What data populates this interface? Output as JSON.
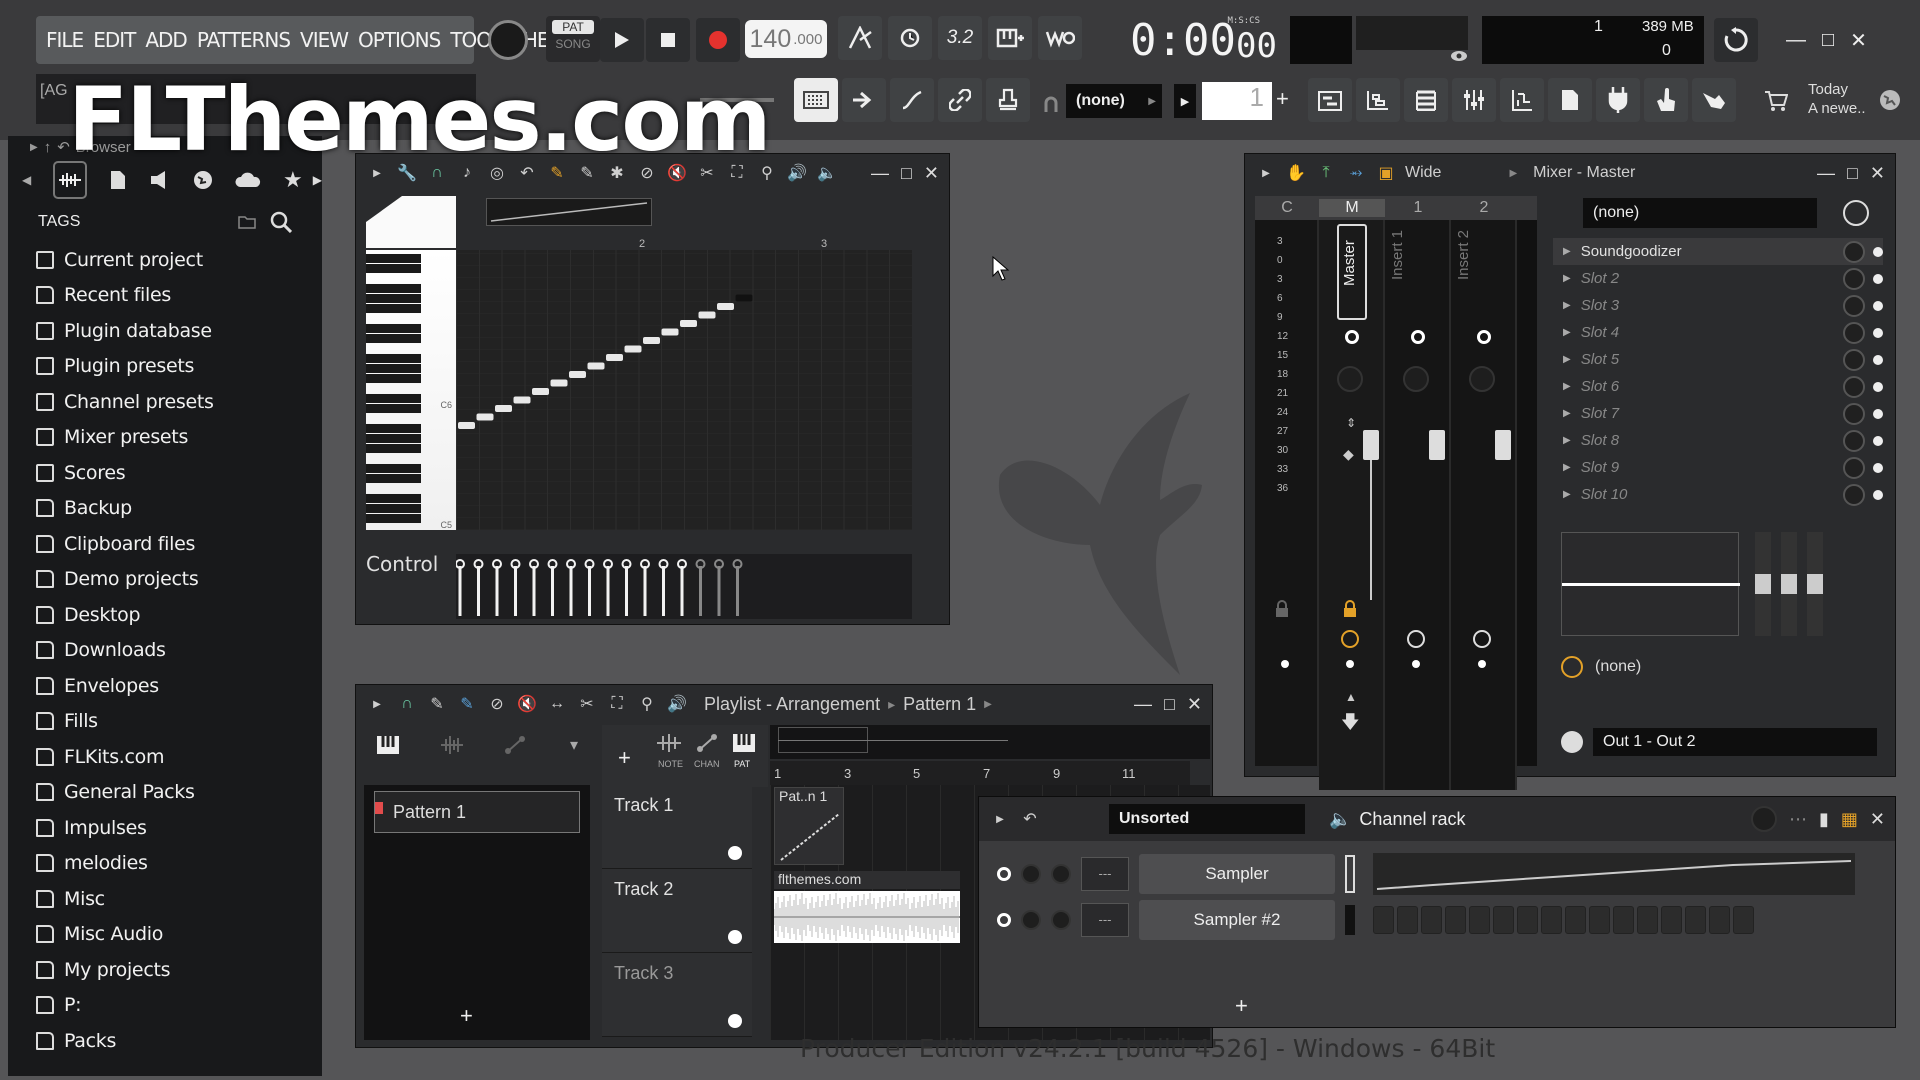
{
  "menu": {
    "file": "FILE",
    "edit": "EDIT",
    "add": "ADD",
    "patterns": "PATTERNS",
    "view": "VIEW",
    "options": "OPTIONS",
    "tools": "TOOLS",
    "help": "HELP"
  },
  "transport": {
    "pat": "PAT",
    "song": "SONG",
    "tempo_main": "140",
    "tempo_frac": ".000",
    "time_main": "0:00",
    "time_sub": "00",
    "time_label": "M:S:CS",
    "time_sig": "3.2"
  },
  "hint": {
    "title": "[AG"
  },
  "cpu": {
    "count": "1",
    "mem": "389 MB",
    "voices": "0"
  },
  "snap": {
    "value": "(none)",
    "pattern_num": "1"
  },
  "news": {
    "line1": "Today",
    "line2": "A newe.."
  },
  "watermark": "FLThemes.com",
  "browser": {
    "title": "Browser",
    "tags": "TAGS",
    "items": [
      {
        "label": "Current project"
      },
      {
        "label": "Recent files"
      },
      {
        "label": "Plugin database"
      },
      {
        "label": "Plugin presets"
      },
      {
        "label": "Channel presets"
      },
      {
        "label": "Mixer presets"
      },
      {
        "label": "Scores"
      },
      {
        "label": "Backup"
      },
      {
        "label": "Clipboard files"
      },
      {
        "label": "Demo projects"
      },
      {
        "label": "Desktop"
      },
      {
        "label": "Downloads"
      },
      {
        "label": "Envelopes"
      },
      {
        "label": "Fills"
      },
      {
        "label": "FLKits.com"
      },
      {
        "label": "General Packs"
      },
      {
        "label": "Impulses"
      },
      {
        "label": "melodies"
      },
      {
        "label": "Misc"
      },
      {
        "label": "Misc Audio"
      },
      {
        "label": "My projects"
      },
      {
        "label": "P:"
      },
      {
        "label": "Packs"
      }
    ]
  },
  "pianoroll": {
    "control": "Control",
    "bar2": "2",
    "bar3": "3",
    "c6": "C6",
    "c5": "C5"
  },
  "playlist": {
    "title": "Playlist - Arrangement",
    "pattern": "Pattern 1",
    "pattern_item": "Pattern 1",
    "tabs": {
      "note": "NOTE",
      "chan": "CHAN",
      "pat": "PAT"
    },
    "bars": [
      "1",
      "3",
      "5",
      "7",
      "9",
      "11"
    ],
    "tracks": [
      {
        "name": "Track 1"
      },
      {
        "name": "Track 2"
      },
      {
        "name": "Track 3"
      }
    ],
    "clip1": "Pat..n 1",
    "clip2": "flthemes.com"
  },
  "mixer": {
    "title": "Mixer - Master",
    "view": "Wide",
    "cols": {
      "c": "C",
      "m": "M",
      "one": "1",
      "two": "2"
    },
    "strips": {
      "master": "Master",
      "insert1": "Insert 1",
      "insert2": "Insert 2"
    },
    "meter": [
      "3",
      "0",
      "3",
      "6",
      "9",
      "12",
      "15",
      "18",
      "21",
      "24",
      "27",
      "30",
      "33",
      "36"
    ],
    "preset": "(none)",
    "slots": [
      {
        "label": "Soundgoodizer"
      },
      {
        "label": "Slot 2"
      },
      {
        "label": "Slot 3"
      },
      {
        "label": "Slot 4"
      },
      {
        "label": "Slot 5"
      },
      {
        "label": "Slot 6"
      },
      {
        "label": "Slot 7"
      },
      {
        "label": "Slot 8"
      },
      {
        "label": "Slot 9"
      },
      {
        "label": "Slot 10"
      }
    ],
    "eq_preset": "(none)",
    "out": "Out 1 - Out 2"
  },
  "channelrack": {
    "filter": "Unsorted",
    "title": "Channel rack",
    "ch1": "Sampler",
    "ch2": "Sampler #2",
    "route": "---"
  },
  "footer": "Producer Edition v24.2.1 [build 4526] - Windows - 64Bit",
  "colors": {
    "accent_orange": "#e3a128",
    "record": "#e5322e",
    "bg": "#555557"
  }
}
